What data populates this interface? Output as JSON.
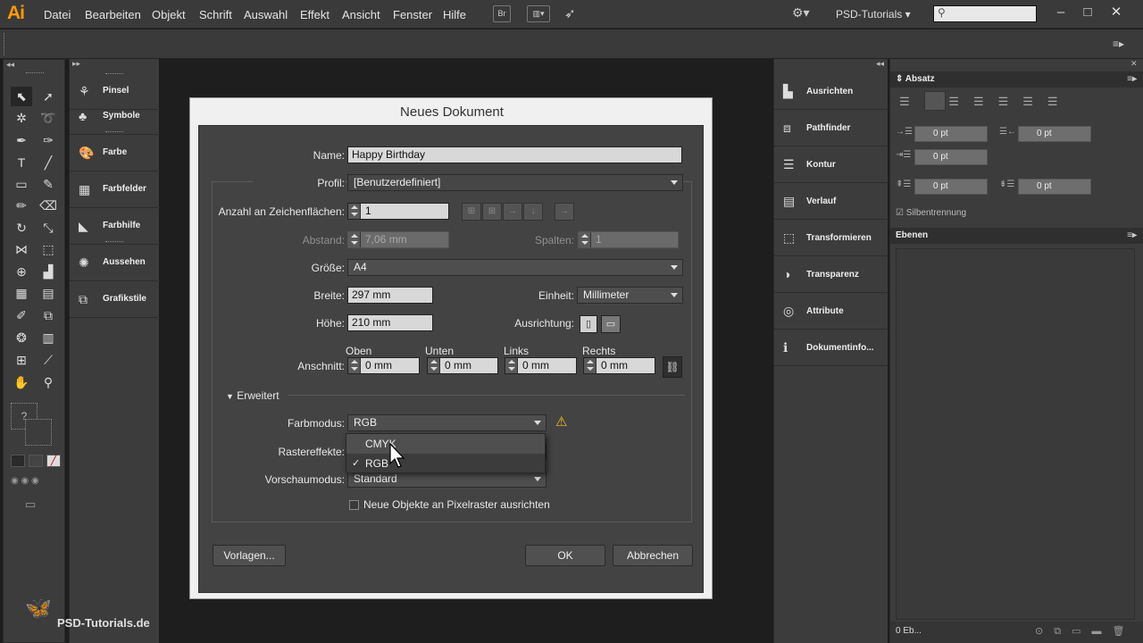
{
  "menubar": {
    "logo": "Ai",
    "items": [
      "Datei",
      "Bearbeiten",
      "Objekt",
      "Schrift",
      "Auswahl",
      "Effekt",
      "Ansicht",
      "Fenster",
      "Hilfe"
    ],
    "bridge_label": "Br",
    "workspace": "PSD-Tutorials",
    "search_placeholder": ""
  },
  "left_panels": [
    "Pinsel",
    "Symbole",
    "Farbe",
    "Farbfelder",
    "Farbhilfe",
    "Aussehen",
    "Grafikstile"
  ],
  "right_panels": [
    "Ausrichten",
    "Pathfinder",
    "Kontur",
    "Verlauf",
    "Transformieren",
    "Transparenz",
    "Attribute",
    "Dokumentinfo..."
  ],
  "paragraph_panel": {
    "title": "Absatz",
    "fields": [
      "0 pt",
      "0 pt",
      "0 pt",
      "0 pt",
      "0 pt"
    ],
    "hyphenation": "Silbentrennung"
  },
  "layers_panel": {
    "title": "Ebenen",
    "footer": "0 Eb..."
  },
  "dialog": {
    "title": "Neues Dokument",
    "name_label": "Name:",
    "name_value": "Happy Birthday",
    "profile_label": "Profil:",
    "profile_value": "[Benutzerdefiniert]",
    "artboards_label": "Anzahl an Zeichenflächen:",
    "artboards_value": "1",
    "spacing_label": "Abstand:",
    "spacing_value": "7,06 mm",
    "columns_label": "Spalten:",
    "columns_value": "1",
    "size_label": "Größe:",
    "size_value": "A4",
    "width_label": "Breite:",
    "width_value": "297 mm",
    "unit_label": "Einheit:",
    "unit_value": "Millimeter",
    "height_label": "Höhe:",
    "height_value": "210 mm",
    "orientation_label": "Ausrichtung:",
    "bleed_label": "Anschnitt:",
    "bleed_top_label": "Oben",
    "bleed_bottom_label": "Unten",
    "bleed_left_label": "Links",
    "bleed_right_label": "Rechts",
    "bleed_top": "0 mm",
    "bleed_bottom": "0 mm",
    "bleed_left": "0 mm",
    "bleed_right": "0 mm",
    "advanced_label": "Erweitert",
    "colormode_label": "Farbmodus:",
    "colormode_value": "RGB",
    "raster_label": "Rastereffekte:",
    "preview_label": "Vorschaumodus:",
    "preview_value": "Standard",
    "pixel_grid_label": "Neue Objekte an Pixelraster ausrichten",
    "templates_button": "Vorlagen...",
    "ok_button": "OK",
    "cancel_button": "Abbrechen"
  },
  "colormode_popup": {
    "options": [
      "CMYK",
      "RGB"
    ],
    "checked": "RGB",
    "check_mark": "✓"
  },
  "watermark": "PSD-Tutorials.de"
}
